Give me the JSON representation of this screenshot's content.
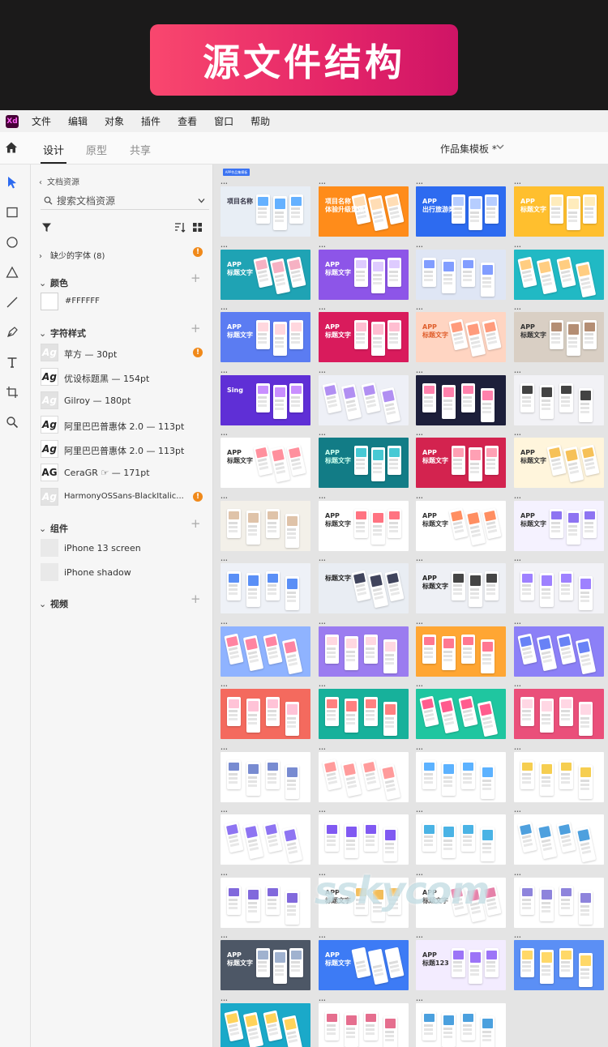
{
  "banner": {
    "title": "源文件结构"
  },
  "app": {
    "logo": "Xd"
  },
  "menu": [
    "文件",
    "编辑",
    "对象",
    "插件",
    "查看",
    "窗口",
    "帮助"
  ],
  "modes": {
    "design": "设计",
    "prototype": "原型",
    "share": "共享"
  },
  "document": {
    "title": "作品集模板 *"
  },
  "assets": {
    "back_label": "文档资源",
    "search_placeholder": "搜索文档资源",
    "missing_fonts": "缺少的字体 (8)",
    "colors_header": "颜色",
    "colors": [
      {
        "label": "#FFFFFF",
        "hex": "#FFFFFF"
      }
    ],
    "char_header": "字符样式",
    "char_styles": [
      {
        "label": "苹方 — 30pt",
        "missing": true,
        "warn": true
      },
      {
        "label": "优设标题黑 — 154pt",
        "missing": false,
        "warn": false
      },
      {
        "label": "Gilroy — 180pt",
        "missing": true,
        "warn": false
      },
      {
        "label": "阿里巴巴普惠体 2.0 — 113pt",
        "missing": false,
        "warn": false
      },
      {
        "label": "阿里巴巴普惠体 2.0 — 113pt",
        "missing": false,
        "warn": false
      },
      {
        "label": "CeraGR ☞ — 171pt",
        "missing": false,
        "warn": false
      },
      {
        "label": "HarmonyOSSans-BlackItalic...",
        "missing": true,
        "warn": true
      }
    ],
    "ag_glyph": "Ag",
    "ag_glyph_caps": "AG",
    "components_header": "组件",
    "components": [
      "iPhone 13 screen",
      "iPhone shadow"
    ],
    "video_header": "视频",
    "warn_glyph": "!"
  },
  "canvas": {
    "tag": "APP作品集模板",
    "watermark": "sskycom",
    "artboards": [
      {
        "bg": "#e8eef5",
        "tone": "#4aa3ff",
        "title": "项目名称",
        "color": "#334"
      },
      {
        "bg": "#ff8c1a",
        "tone": "#ffd7a8",
        "title": "项目名称\n体验升级重做",
        "color": "#fff"
      },
      {
        "bg": "#2d6bf0",
        "tone": "#a9c4ff",
        "title": "APP\n出行旅游类",
        "color": "#fff"
      },
      {
        "bg": "#ffbf2e",
        "tone": "#ffe9b0",
        "title": "APP\n标题文字",
        "color": "#fff"
      },
      {
        "bg": "#1fa3b4",
        "tone": "#f5a3b9",
        "title": "APP\n标题文字",
        "color": "#fff"
      },
      {
        "bg": "#8d55e8",
        "tone": "#d8c2ff",
        "title": "APP\n标题文字",
        "color": "#fff"
      },
      {
        "bg": "#dfe6f5",
        "tone": "#6b8cff",
        "title": "",
        "color": "#333"
      },
      {
        "bg": "#21b9c4",
        "tone": "#ffc46b",
        "title": "",
        "color": "#fff"
      },
      {
        "bg": "#5b7cf2",
        "tone": "#ffd0d8",
        "title": "APP\n标题文字",
        "color": "#fff"
      },
      {
        "bg": "#d91b5c",
        "tone": "#ffb3c9",
        "title": "APP\n标题文字",
        "color": "#fff"
      },
      {
        "bg": "#ffd5c2",
        "tone": "#ff8a65",
        "title": "APP\n标题文字",
        "color": "#e0602e"
      },
      {
        "bg": "#d9cfc4",
        "tone": "#a77a5c",
        "title": "APP\n标题文字",
        "color": "#333"
      },
      {
        "bg": "#5f2fd6",
        "tone": "#c07bff",
        "title": "Sing",
        "color": "#fff"
      },
      {
        "bg": "#eef0f7",
        "tone": "#a37bf0",
        "title": "",
        "color": "#333"
      },
      {
        "bg": "#1d1f3a",
        "tone": "#ff6b9d",
        "title": "",
        "color": "#fff"
      },
      {
        "bg": "#f2f2f6",
        "tone": "#222",
        "title": "",
        "color": "#333"
      },
      {
        "bg": "#ffffff",
        "tone": "#ff7d8c",
        "title": "APP\n标题文字",
        "color": "#333"
      },
      {
        "bg": "#127c86",
        "tone": "#27c0cc",
        "title": "APP\n标题文字",
        "color": "#cfe"
      },
      {
        "bg": "#d3234f",
        "tone": "#ff8fa7",
        "title": "APP\n标题文字",
        "color": "#fff"
      },
      {
        "bg": "#fff5dc",
        "tone": "#f4b63b",
        "title": "APP\n标题文字",
        "color": "#333"
      },
      {
        "bg": "#f3f0e9",
        "tone": "#d9b89a",
        "title": "",
        "color": "#333"
      },
      {
        "bg": "#ffffff",
        "tone": "#ff5b6b",
        "title": "APP\n标题文字",
        "color": "#333"
      },
      {
        "bg": "#ffffff",
        "tone": "#ff7a45",
        "title": "APP\n标题文字",
        "color": "#333"
      },
      {
        "bg": "#f5f2ff",
        "tone": "#7a5cf0",
        "title": "APP\n标题文字",
        "color": "#333"
      },
      {
        "bg": "#eef1f7",
        "tone": "#3d7bf5",
        "title": "",
        "color": "#333"
      },
      {
        "bg": "#e9edf3",
        "tone": "#1f2340",
        "title": "标题文字",
        "color": "#222"
      },
      {
        "bg": "#eef0f5",
        "tone": "#242424",
        "title": "APP\n标题文字",
        "color": "#222"
      },
      {
        "bg": "#f2f2f7",
        "tone": "#8d6bff",
        "title": "",
        "color": "#333"
      },
      {
        "bg": "#8fb3ff",
        "tone": "#ff6f91",
        "title": "",
        "color": "#fff"
      },
      {
        "bg": "#9b7cf0",
        "tone": "#ffd1dc",
        "title": "",
        "color": "#fff"
      },
      {
        "bg": "#ffa633",
        "tone": "#ff5f7e",
        "title": "",
        "color": "#fff"
      },
      {
        "bg": "#8c80f7",
        "tone": "#4e6cf5",
        "title": "",
        "color": "#fff"
      },
      {
        "bg": "#f46a5e",
        "tone": "#ffb9d0",
        "title": "",
        "color": "#fff"
      },
      {
        "bg": "#17b19b",
        "tone": "#ff6a6a",
        "title": "",
        "color": "#fff"
      },
      {
        "bg": "#1fc6a0",
        "tone": "#ff3f7a",
        "title": "",
        "color": "#fff"
      },
      {
        "bg": "#ea4f7a",
        "tone": "#ffd0df",
        "title": "",
        "color": "#fff"
      },
      {
        "bg": "#ffffff",
        "tone": "#6077c9",
        "title": "",
        "color": "#333"
      },
      {
        "bg": "#ffffff",
        "tone": "#ff8a8a",
        "title": "",
        "color": "#333"
      },
      {
        "bg": "#ffffff",
        "tone": "#3fa5ff",
        "title": "",
        "color": "#333"
      },
      {
        "bg": "#ffffff",
        "tone": "#f5c531",
        "title": "",
        "color": "#333"
      },
      {
        "bg": "#ffffff",
        "tone": "#7a5cf0",
        "title": "",
        "color": "#333"
      },
      {
        "bg": "#ffffff",
        "tone": "#6a3cf0",
        "title": "",
        "color": "#333"
      },
      {
        "bg": "#ffffff",
        "tone": "#2aa6e0",
        "title": "",
        "color": "#333"
      },
      {
        "bg": "#ffffff",
        "tone": "#2f8fd8",
        "title": "",
        "color": "#333"
      },
      {
        "bg": "#ffffff",
        "tone": "#6b4fd6",
        "title": "",
        "color": "#333"
      },
      {
        "bg": "#ffffff",
        "tone": "#f0b13d",
        "title": "APP\n标题文字",
        "color": "#333"
      },
      {
        "bg": "#ffffff",
        "tone": "#e06b9a",
        "title": "APP\n标题文字",
        "color": "#333"
      },
      {
        "bg": "#ffffff",
        "tone": "#7a6fd6",
        "title": "",
        "color": "#333"
      },
      {
        "bg": "#4d5766",
        "tone": "#8fa4c7",
        "title": "APP\n标题文字",
        "color": "#fff"
      },
      {
        "bg": "#3d7bf5",
        "tone": "#ffffff",
        "title": "APP\n标题文字",
        "color": "#fff"
      },
      {
        "bg": "#f3ecff",
        "tone": "#8b5cf6",
        "title": "APP\n标题123",
        "color": "#333"
      },
      {
        "bg": "#5b8ff5",
        "tone": "#ffd14d",
        "title": "",
        "color": "#fff"
      },
      {
        "bg": "#1aa9c9",
        "tone": "#ffcb3d",
        "title": "",
        "color": "#fff"
      },
      {
        "bg": "#ffffff",
        "tone": "#e0557a",
        "title": "",
        "color": "#333"
      },
      {
        "bg": "#ffffff",
        "tone": "#2b8fd8",
        "title": "",
        "color": "#333"
      }
    ]
  }
}
